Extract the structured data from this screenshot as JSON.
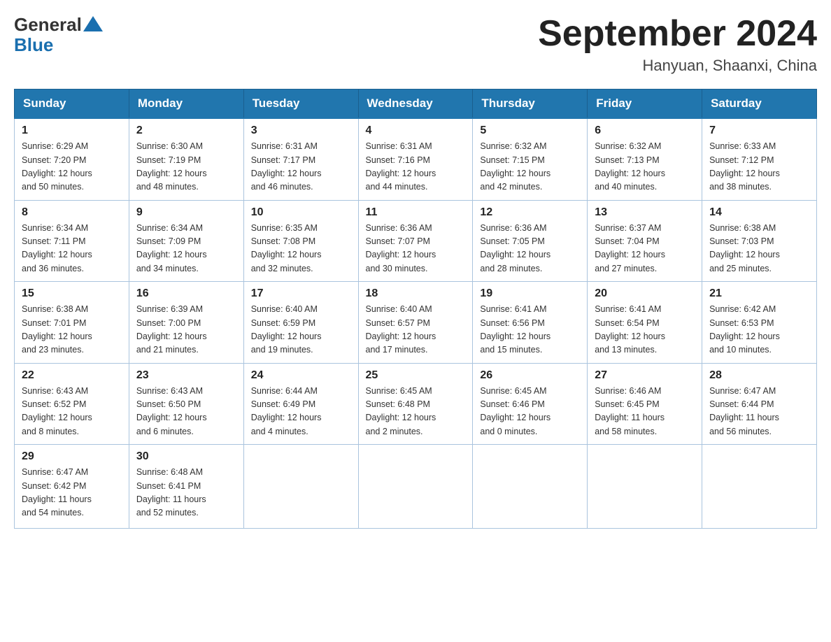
{
  "header": {
    "logo": {
      "general": "General",
      "blue": "Blue"
    },
    "title": "September 2024",
    "location": "Hanyuan, Shaanxi, China"
  },
  "weekdays": [
    "Sunday",
    "Monday",
    "Tuesday",
    "Wednesday",
    "Thursday",
    "Friday",
    "Saturday"
  ],
  "weeks": [
    [
      {
        "day": "1",
        "sunrise": "6:29 AM",
        "sunset": "7:20 PM",
        "daylight": "12 hours and 50 minutes."
      },
      {
        "day": "2",
        "sunrise": "6:30 AM",
        "sunset": "7:19 PM",
        "daylight": "12 hours and 48 minutes."
      },
      {
        "day": "3",
        "sunrise": "6:31 AM",
        "sunset": "7:17 PM",
        "daylight": "12 hours and 46 minutes."
      },
      {
        "day": "4",
        "sunrise": "6:31 AM",
        "sunset": "7:16 PM",
        "daylight": "12 hours and 44 minutes."
      },
      {
        "day": "5",
        "sunrise": "6:32 AM",
        "sunset": "7:15 PM",
        "daylight": "12 hours and 42 minutes."
      },
      {
        "day": "6",
        "sunrise": "6:32 AM",
        "sunset": "7:13 PM",
        "daylight": "12 hours and 40 minutes."
      },
      {
        "day": "7",
        "sunrise": "6:33 AM",
        "sunset": "7:12 PM",
        "daylight": "12 hours and 38 minutes."
      }
    ],
    [
      {
        "day": "8",
        "sunrise": "6:34 AM",
        "sunset": "7:11 PM",
        "daylight": "12 hours and 36 minutes."
      },
      {
        "day": "9",
        "sunrise": "6:34 AM",
        "sunset": "7:09 PM",
        "daylight": "12 hours and 34 minutes."
      },
      {
        "day": "10",
        "sunrise": "6:35 AM",
        "sunset": "7:08 PM",
        "daylight": "12 hours and 32 minutes."
      },
      {
        "day": "11",
        "sunrise": "6:36 AM",
        "sunset": "7:07 PM",
        "daylight": "12 hours and 30 minutes."
      },
      {
        "day": "12",
        "sunrise": "6:36 AM",
        "sunset": "7:05 PM",
        "daylight": "12 hours and 28 minutes."
      },
      {
        "day": "13",
        "sunrise": "6:37 AM",
        "sunset": "7:04 PM",
        "daylight": "12 hours and 27 minutes."
      },
      {
        "day": "14",
        "sunrise": "6:38 AM",
        "sunset": "7:03 PM",
        "daylight": "12 hours and 25 minutes."
      }
    ],
    [
      {
        "day": "15",
        "sunrise": "6:38 AM",
        "sunset": "7:01 PM",
        "daylight": "12 hours and 23 minutes."
      },
      {
        "day": "16",
        "sunrise": "6:39 AM",
        "sunset": "7:00 PM",
        "daylight": "12 hours and 21 minutes."
      },
      {
        "day": "17",
        "sunrise": "6:40 AM",
        "sunset": "6:59 PM",
        "daylight": "12 hours and 19 minutes."
      },
      {
        "day": "18",
        "sunrise": "6:40 AM",
        "sunset": "6:57 PM",
        "daylight": "12 hours and 17 minutes."
      },
      {
        "day": "19",
        "sunrise": "6:41 AM",
        "sunset": "6:56 PM",
        "daylight": "12 hours and 15 minutes."
      },
      {
        "day": "20",
        "sunrise": "6:41 AM",
        "sunset": "6:54 PM",
        "daylight": "12 hours and 13 minutes."
      },
      {
        "day": "21",
        "sunrise": "6:42 AM",
        "sunset": "6:53 PM",
        "daylight": "12 hours and 10 minutes."
      }
    ],
    [
      {
        "day": "22",
        "sunrise": "6:43 AM",
        "sunset": "6:52 PM",
        "daylight": "12 hours and 8 minutes."
      },
      {
        "day": "23",
        "sunrise": "6:43 AM",
        "sunset": "6:50 PM",
        "daylight": "12 hours and 6 minutes."
      },
      {
        "day": "24",
        "sunrise": "6:44 AM",
        "sunset": "6:49 PM",
        "daylight": "12 hours and 4 minutes."
      },
      {
        "day": "25",
        "sunrise": "6:45 AM",
        "sunset": "6:48 PM",
        "daylight": "12 hours and 2 minutes."
      },
      {
        "day": "26",
        "sunrise": "6:45 AM",
        "sunset": "6:46 PM",
        "daylight": "12 hours and 0 minutes."
      },
      {
        "day": "27",
        "sunrise": "6:46 AM",
        "sunset": "6:45 PM",
        "daylight": "11 hours and 58 minutes."
      },
      {
        "day": "28",
        "sunrise": "6:47 AM",
        "sunset": "6:44 PM",
        "daylight": "11 hours and 56 minutes."
      }
    ],
    [
      {
        "day": "29",
        "sunrise": "6:47 AM",
        "sunset": "6:42 PM",
        "daylight": "11 hours and 54 minutes."
      },
      {
        "day": "30",
        "sunrise": "6:48 AM",
        "sunset": "6:41 PM",
        "daylight": "11 hours and 52 minutes."
      },
      null,
      null,
      null,
      null,
      null
    ]
  ]
}
